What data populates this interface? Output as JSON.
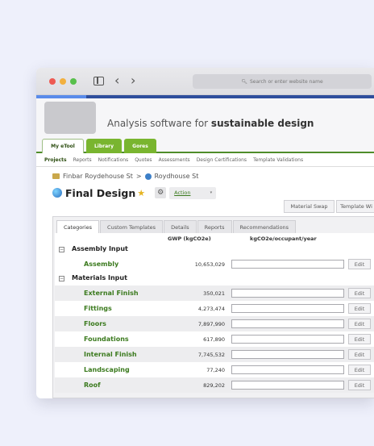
{
  "browser": {
    "url_placeholder": "Search or enter website name",
    "back_glyph": "‹",
    "forward_glyph": "›"
  },
  "header": {
    "tagline_prefix": "Analysis software for ",
    "tagline_bold": "sustainable design"
  },
  "top_tabs": [
    "My eTool",
    "Library",
    "Gores"
  ],
  "subnav": [
    "Projects",
    "Reports",
    "Notifications",
    "Quotes",
    "Assessments",
    "Design Certifications",
    "Template Validations"
  ],
  "breadcrumb": {
    "first": "Finbar Roydehouse St",
    "separator": ">",
    "second": "Roydhouse St"
  },
  "page": {
    "title": "Final Design",
    "action_label": "Action"
  },
  "right_buttons": [
    "Material Swap",
    "Template Wi"
  ],
  "panel_tabs": [
    "Categories",
    "Custom Templates",
    "Details",
    "Reports",
    "Recommendations"
  ],
  "table": {
    "columns": {
      "gwp": "GWP (kgCO2e)",
      "per_occupant": "kgCO2e/occupant/year"
    },
    "edit_label": "Edit",
    "groups": [
      {
        "name": "Assembly Input",
        "items": [
          {
            "name": "Assembly",
            "gwp": "10,653,029"
          }
        ]
      },
      {
        "name": "Materials Input",
        "items": [
          {
            "name": "External Finish",
            "gwp": "350,021"
          },
          {
            "name": "Fittings",
            "gwp": "4,273,474"
          },
          {
            "name": "Floors",
            "gwp": "7,897,990"
          },
          {
            "name": "Foundations",
            "gwp": "617,890"
          },
          {
            "name": "Internal Finish",
            "gwp": "7,745,532"
          },
          {
            "name": "Landscaping",
            "gwp": "77,240"
          },
          {
            "name": "Roof",
            "gwp": "829,202"
          }
        ]
      }
    ]
  },
  "colors": {
    "brand_green": "#79b52f",
    "link_green": "#3b7a1e",
    "nav_blue": "#2e4e9c"
  }
}
